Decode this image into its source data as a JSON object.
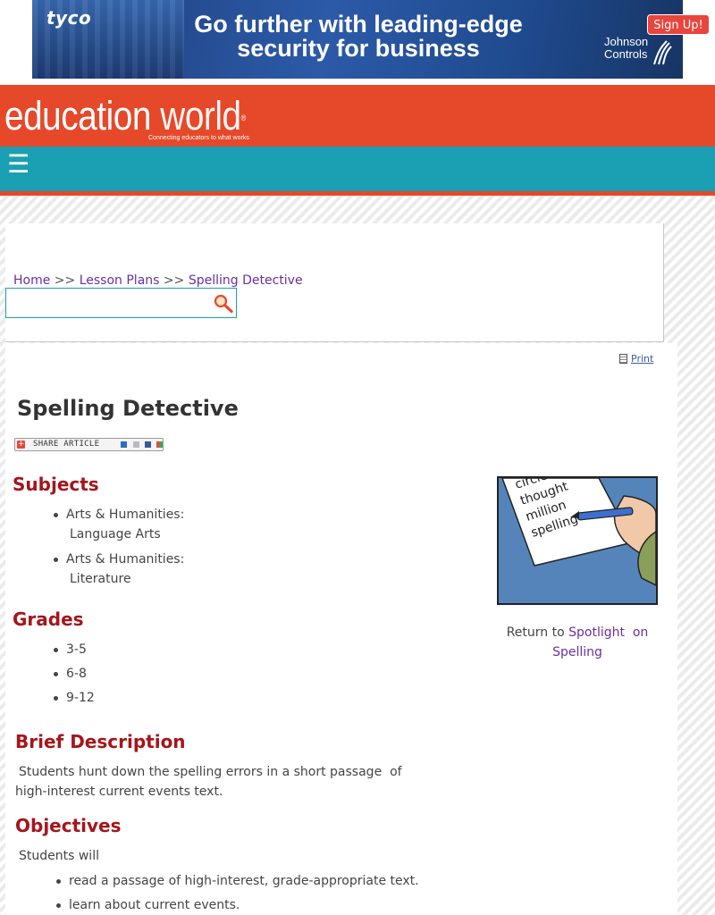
{
  "ad": {
    "brand": "tyco",
    "headline_line1": "Go further with leading-edge",
    "headline_line2": "security for business",
    "sponsor_line1": "Johnson",
    "sponsor_line2": "Controls",
    "signup_label": "Sign Up!"
  },
  "header": {
    "logo_word1": "education",
    "logo_word2": "world",
    "logo_mark": "®",
    "tagline": "Connecting educators to what works",
    "menu_icon": "☰"
  },
  "breadcrumb": {
    "home": "Home",
    "sep": ">>",
    "lesson_plans": "Lesson Plans",
    "current": "Spelling Detective"
  },
  "search": {
    "placeholder": "",
    "value": ""
  },
  "print": {
    "label": "Print"
  },
  "article": {
    "title": "Spelling Detective",
    "share_label": "SHARE ARTICLE"
  },
  "subjects": {
    "heading": "Subjects",
    "items": [
      {
        "line1": "Arts & Humanities:",
        "line2": "Language Arts"
      },
      {
        "line1": "Arts & Humanities:",
        "line2": "Literature"
      }
    ]
  },
  "grades": {
    "heading": "Grades",
    "items": [
      "3-5",
      "6-8",
      "9-12"
    ]
  },
  "brief": {
    "heading": "Brief Description",
    "text_line1": "Students hunt down the spelling errors in a short passage  of",
    "text_line2": "high-interest current events text."
  },
  "objectives": {
    "heading": "Objectives",
    "intro": "Students will",
    "items": [
      "read a passage of high-interest, grade-appropriate text.",
      "learn about current events."
    ]
  },
  "sidebar": {
    "illustration_words": [
      "circle",
      "thought",
      "million",
      "spelling"
    ],
    "return_prefix": "Return to",
    "return_link_1": "Spotlight  on",
    "return_link_2": "Spelling"
  },
  "colors": {
    "header_orange": "#e5492a",
    "nav_teal": "#1b9fb2",
    "heading_red": "#a6151b",
    "link_purple": "#6a2fa3"
  }
}
